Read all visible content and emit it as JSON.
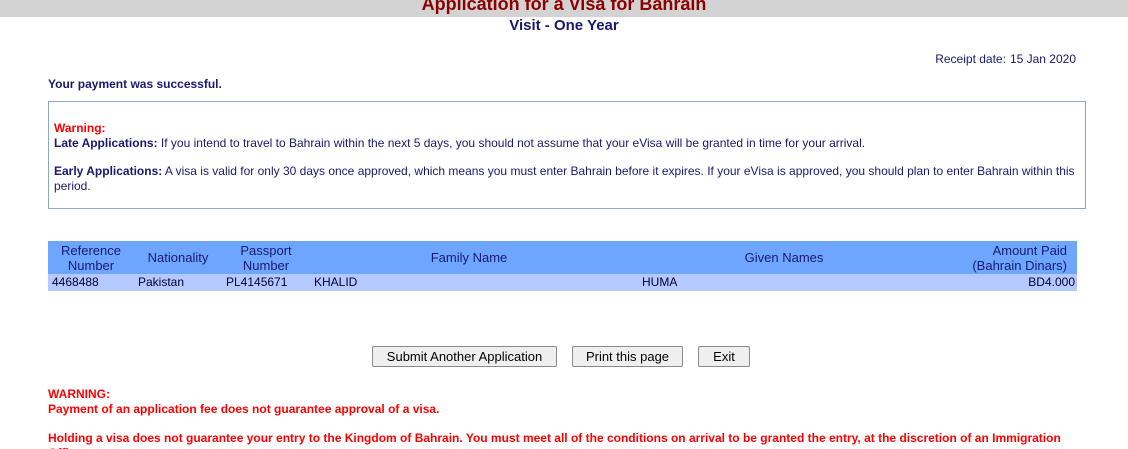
{
  "header": {
    "title": "Application for a Visa for Bahrain",
    "subtitle": "Visit - One Year"
  },
  "receipt": {
    "label": "Receipt date:",
    "date": "15 Jan 2020"
  },
  "payment_message": "Your payment was successful.",
  "warning_box": {
    "heading": "Warning:",
    "late_label": "Late Applications:",
    "late_text": "If you intend to travel to Bahrain within the next 5 days, you should not assume that your eVisa will be granted in time for your arrival.",
    "early_label": "Early Applications:",
    "early_text": "A visa is valid for only 30 days once approved, which means you must enter Bahrain before it expires. If your eVisa is approved, you should plan to enter Bahrain within this period."
  },
  "table": {
    "headers": [
      "Reference Number",
      "Nationality",
      "Passport Number",
      "Family Name",
      "Given Names",
      "Amount Paid (Bahrain Dinars)"
    ],
    "rows": [
      {
        "reference": "4468488",
        "nationality": "Pakistan",
        "passport": "PL4145671",
        "family_name": "KHALID",
        "given_names": "HUMA",
        "amount": "BD4.000"
      }
    ]
  },
  "buttons": {
    "submit_another": "Submit Another Application",
    "print": "Print this page",
    "exit": "Exit"
  },
  "footer": {
    "heading": "WARNING:",
    "line1": "Payment of an application fee does not guarantee approval of a visa.",
    "line2": "Holding a visa does not guarantee your entry to the Kingdom of Bahrain. You must meet all of the conditions on arrival to be granted the entry, at the discretion of an Immigration Officer."
  },
  "colors": {
    "title_red": "#8b0000",
    "navy_text": "#191970",
    "warning_red": "#ff0000",
    "table_header_bg": "#6ea6ff",
    "table_row_bg": "#b3c9ff",
    "title_bar_bg": "#d3d3d3"
  }
}
